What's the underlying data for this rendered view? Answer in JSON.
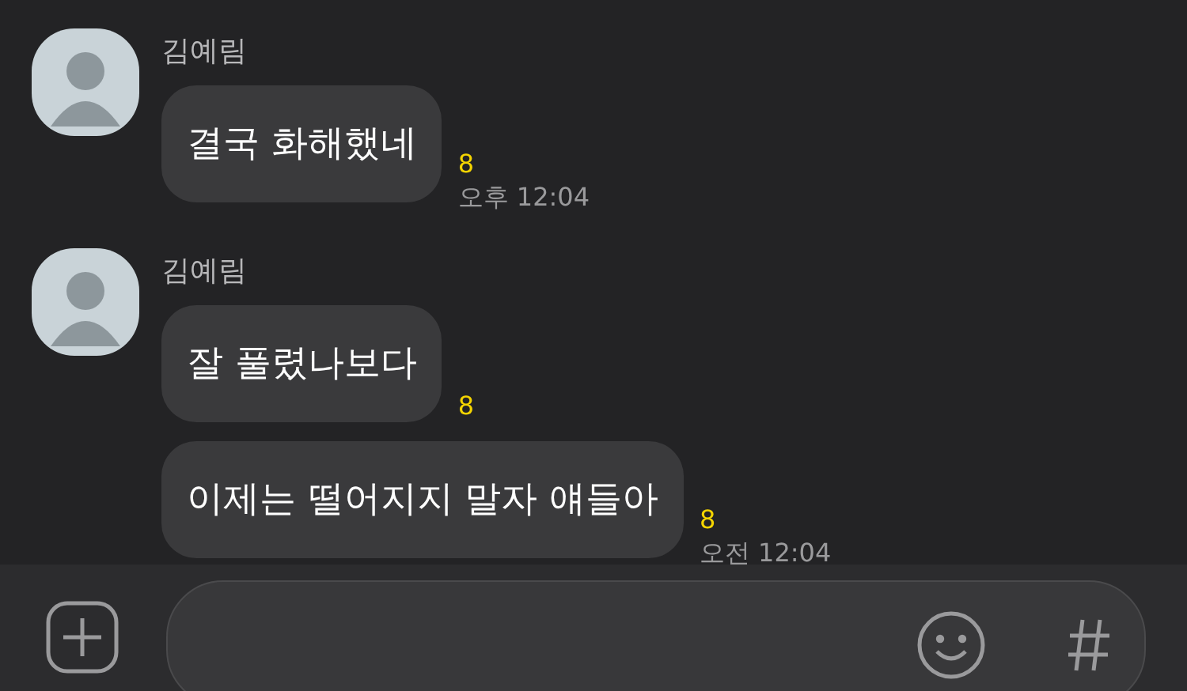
{
  "messages": [
    {
      "sender": "김예림",
      "text": "결국 화해했네",
      "unread": "8",
      "time": "오후 12:04"
    },
    {
      "sender": "김예림",
      "text": "잘 풀렸나보다",
      "unread": "8"
    },
    {
      "text": "이제는 떨어지지 말자 얘들아",
      "unread": "8",
      "time": "오전 12:04"
    }
  ]
}
